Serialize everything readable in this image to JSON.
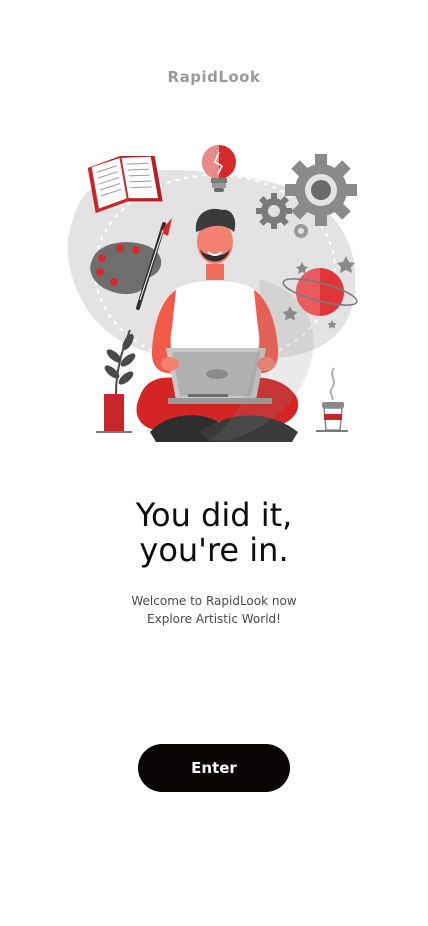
{
  "app": {
    "title": "RapidLook"
  },
  "hero": {
    "illustration": "artist-with-laptop-illustration",
    "colors": {
      "accent": "#d62a2a",
      "gray": "#8a8a8a",
      "light_gray": "#e3e3e3",
      "dark": "#2e2e2e"
    }
  },
  "content": {
    "headline_line1": "You did it,",
    "headline_line2": "you're in.",
    "subtext_line1": "Welcome to RapidLook now",
    "subtext_line2": "Explore Artistic World!"
  },
  "actions": {
    "enter_label": "Enter"
  },
  "theme": {
    "button_bg": "#0a0505",
    "button_text": "#ffffff"
  }
}
